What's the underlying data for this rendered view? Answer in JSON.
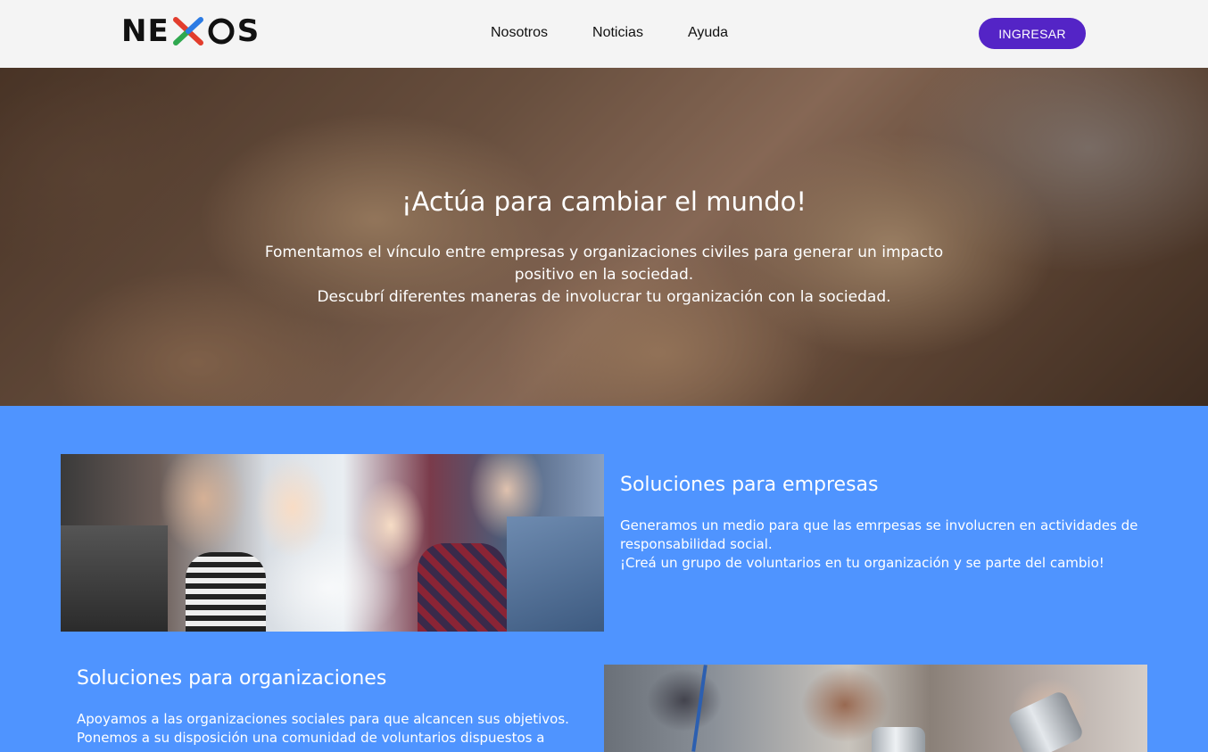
{
  "header": {
    "logo": {
      "letters_before": "NE",
      "letter_x": "X",
      "letter_o": "O",
      "letters_after": "S",
      "colors": [
        "#e23d2d",
        "#2fa84f",
        "#f2b51c",
        "#2b7be4"
      ]
    },
    "nav": [
      {
        "label": "Nosotros"
      },
      {
        "label": "Noticias"
      },
      {
        "label": "Ayuda"
      }
    ],
    "login_button": "INGRESAR"
  },
  "hero": {
    "title": "¡Actúa para cambiar el mundo!",
    "lines": [
      "Fomentamos el vínculo entre empresas y organizaciones civiles para generar un impacto positivo en la sociedad.",
      "Descubrí diferentes maneras de involucrar tu organización con la sociedad."
    ]
  },
  "sections": [
    {
      "title": "Soluciones para empresas",
      "paragraphs": [
        "Generamos un medio para que las emrpesas se involucren en actividades de responsabilidad social.",
        "¡Creá un grupo de voluntarios en tu organización y se parte del cambio!"
      ]
    },
    {
      "title": "Soluciones para organizaciones",
      "paragraphs": [
        "Apoyamos a las organizaciones sociales para que alcancen sus objetivos.",
        "Ponemos a su disposición una comunidad de voluntarios dispuestos a"
      ]
    }
  ],
  "colors": {
    "header_bg": "#f4f4f4",
    "accent_button": "#5424c6",
    "section_bg": "#4f94ff"
  }
}
